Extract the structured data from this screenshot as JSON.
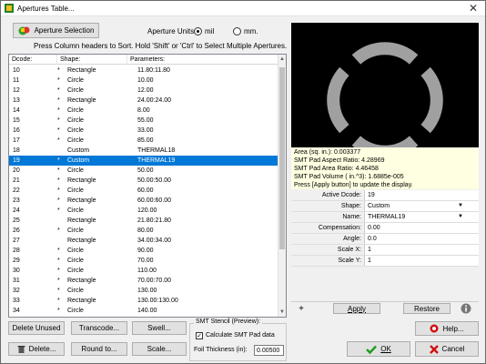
{
  "window": {
    "title": "Apertures Table..."
  },
  "top": {
    "aperture_selection_label": "Aperture Selection",
    "units_label": "Aperture Units:",
    "unit_mil": "mil",
    "unit_mm": "mm.",
    "selected_unit": "mil",
    "hint": "Press Column headers to Sort.  Hold 'Shift' or 'Ctrl' to Select Multiple Apertures."
  },
  "table": {
    "headers": [
      "Dcode:",
      "Shape:",
      "Parameters:"
    ],
    "rows": [
      {
        "dcode": "10",
        "mark": "*",
        "shape": "Rectangle",
        "params": "11.80:11.80"
      },
      {
        "dcode": "11",
        "mark": "*",
        "shape": "Circle",
        "params": "10.00"
      },
      {
        "dcode": "12",
        "mark": "*",
        "shape": "Circle",
        "params": "12.00"
      },
      {
        "dcode": "13",
        "mark": "*",
        "shape": "Rectangle",
        "params": "24.00:24.00"
      },
      {
        "dcode": "14",
        "mark": "*",
        "shape": "Circle",
        "params": "8.00"
      },
      {
        "dcode": "15",
        "mark": "*",
        "shape": "Circle",
        "params": "55.00"
      },
      {
        "dcode": "16",
        "mark": "*",
        "shape": "Circle",
        "params": "33.00"
      },
      {
        "dcode": "17",
        "mark": "*",
        "shape": "Circle",
        "params": "85.00"
      },
      {
        "dcode": "18",
        "mark": "",
        "shape": "Custom",
        "params": "THERMAL18"
      },
      {
        "dcode": "19",
        "mark": "*",
        "shape": "Custom",
        "params": "THERMAL19"
      },
      {
        "dcode": "20",
        "mark": "*",
        "shape": "Circle",
        "params": "50.00"
      },
      {
        "dcode": "21",
        "mark": "*",
        "shape": "Rectangle",
        "params": "50.00:50.00"
      },
      {
        "dcode": "22",
        "mark": "*",
        "shape": "Circle",
        "params": "60.00"
      },
      {
        "dcode": "23",
        "mark": "*",
        "shape": "Rectangle",
        "params": "60.00:60.00"
      },
      {
        "dcode": "24",
        "mark": "*",
        "shape": "Circle",
        "params": "120.00"
      },
      {
        "dcode": "25",
        "mark": "",
        "shape": "Rectangle",
        "params": "21.80:21.80"
      },
      {
        "dcode": "26",
        "mark": "*",
        "shape": "Circle",
        "params": "80.00"
      },
      {
        "dcode": "27",
        "mark": "",
        "shape": "Rectangle",
        "params": "34.00:34.00"
      },
      {
        "dcode": "28",
        "mark": "*",
        "shape": "Circle",
        "params": "90.00"
      },
      {
        "dcode": "29",
        "mark": "*",
        "shape": "Circle",
        "params": "70.00"
      },
      {
        "dcode": "30",
        "mark": "*",
        "shape": "Circle",
        "params": "110.00"
      },
      {
        "dcode": "31",
        "mark": "*",
        "shape": "Rectangle",
        "params": "70.00:70.00"
      },
      {
        "dcode": "32",
        "mark": "*",
        "shape": "Circle",
        "params": "130.00"
      },
      {
        "dcode": "33",
        "mark": "*",
        "shape": "Rectangle",
        "params": "130.00:130.00"
      },
      {
        "dcode": "34",
        "mark": "*",
        "shape": "Circle",
        "params": "140.00"
      }
    ],
    "selected_dcode": "19"
  },
  "info": {
    "lines": [
      "Area (sq. in.): 0.003377",
      "SMT Pad Aspect Ratio: 4.28969",
      "SMT Pad Area Ratio: 4.46458",
      "SMT Pad Volume ( in.^3): 1.6885e-005",
      "Press [Apply button] to update the display."
    ]
  },
  "properties": [
    {
      "label": "Active Dcode:",
      "value": "19",
      "dropdown": false
    },
    {
      "label": "Shape:",
      "value": "Custom",
      "dropdown": true
    },
    {
      "label": "Name:",
      "value": "THERMAL19",
      "dropdown": true
    },
    {
      "label": "Compensation:",
      "value": "0.00",
      "dropdown": false
    },
    {
      "label": "Angle:",
      "value": "0.0",
      "dropdown": false
    },
    {
      "label": "Scale X:",
      "value": "1",
      "dropdown": false
    },
    {
      "label": "Scale Y:",
      "value": "1",
      "dropdown": false
    }
  ],
  "panel_buttons": {
    "add": "+",
    "apply": "Apply",
    "restore": "Restore",
    "info": "i"
  },
  "buttons": {
    "delete_unused": "Delete Unused",
    "transcode": "Transcode...",
    "swell": "Swell...",
    "delete": "Delete...",
    "round_to": "Round to...",
    "scale": "Scale...",
    "help": "Help...",
    "ok": "OK",
    "cancel": "Cancel"
  },
  "smt": {
    "group_label": "SMT Stencil (Preview):",
    "calc_label": "Calculate SMT Pad data",
    "calc_checked": true,
    "foil_label": "Foil Thickness (in):",
    "foil_value": "0.00500"
  },
  "colors": {
    "selection": "#0078d7",
    "ring": "#a0a0a0",
    "preview_bg": "#000000",
    "info_bg": "#ffffe1",
    "ok_green": "#1a9c1a",
    "cancel_red": "#d01010"
  }
}
